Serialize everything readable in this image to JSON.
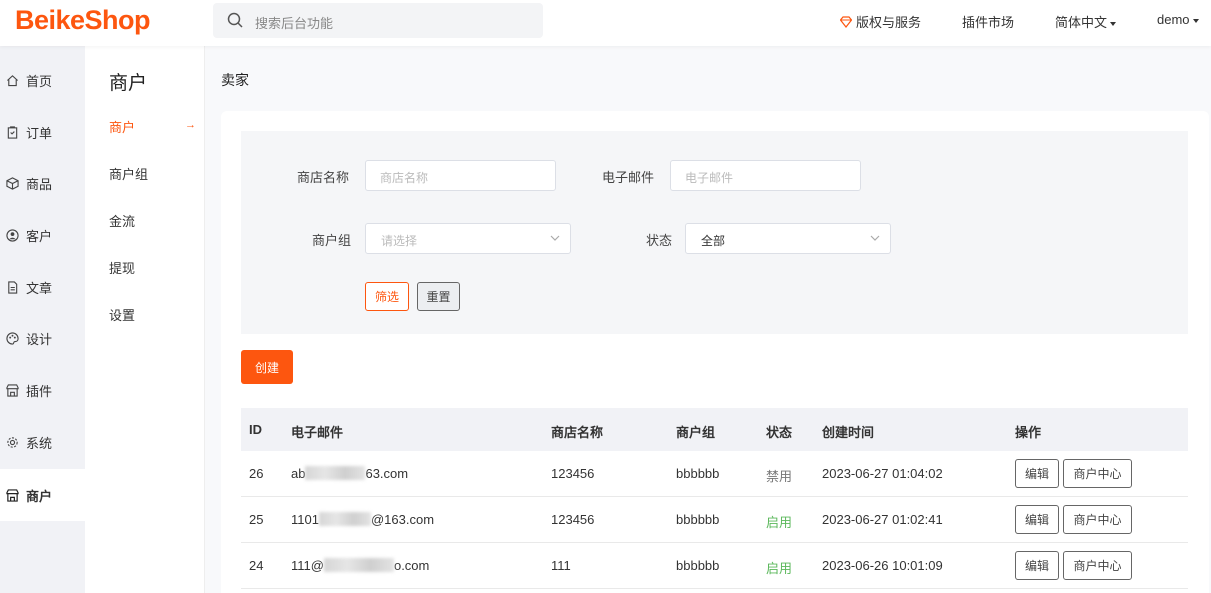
{
  "brand": "BeikeShop",
  "header": {
    "search_placeholder": "搜索后台功能",
    "nav": {
      "license": "版权与服务",
      "plugins": "插件市场",
      "language": "简体中文",
      "user": "demo"
    }
  },
  "sidebar": {
    "items": [
      {
        "label": "首页",
        "icon": "home-icon"
      },
      {
        "label": "订单",
        "icon": "clipboard-icon"
      },
      {
        "label": "商品",
        "icon": "box-icon"
      },
      {
        "label": "客户",
        "icon": "user-icon"
      },
      {
        "label": "文章",
        "icon": "document-icon"
      },
      {
        "label": "设计",
        "icon": "palette-icon"
      },
      {
        "label": "插件",
        "icon": "store-icon"
      },
      {
        "label": "系统",
        "icon": "gear-icon"
      }
    ],
    "active": {
      "label": "商户",
      "icon": "store-icon"
    }
  },
  "subnav": {
    "title": "商户",
    "items": [
      "商户",
      "商户组",
      "金流",
      "提现",
      "设置"
    ],
    "active_index": 0,
    "active_arrow": "→"
  },
  "page": {
    "title": "卖家",
    "filter": {
      "store_name_label": "商店名称",
      "store_name_placeholder": "商店名称",
      "email_label": "电子邮件",
      "email_placeholder": "电子邮件",
      "group_label": "商户组",
      "group_placeholder": "请选择",
      "status_label": "状态",
      "status_value": "全部",
      "filter_button": "筛选",
      "reset_button": "重置"
    },
    "create_button": "创建",
    "table": {
      "headers": [
        "ID",
        "电子邮件",
        "商店名称",
        "商户组",
        "状态",
        "创建时间",
        "操作"
      ],
      "rows": [
        {
          "id": "26",
          "email_pre": "ab",
          "email_post": "63.com",
          "store": "123456",
          "group": "bbbbbb",
          "status": "禁用",
          "status_color": "#777777",
          "created": "2023-06-27 01:04:02",
          "edit": "编辑",
          "center": "商户中心"
        },
        {
          "id": "25",
          "email_pre": "1101",
          "email_post": "@163.com",
          "store": "123456",
          "group": "bbbbbb",
          "status": "启用",
          "status_color": "#5cb85c",
          "created": "2023-06-27 01:02:41",
          "edit": "编辑",
          "center": "商户中心"
        },
        {
          "id": "24",
          "email_pre": "111@",
          "email_post": "o.com",
          "store": "111",
          "group": "bbbbbb",
          "status": "启用",
          "status_color": "#5cb85c",
          "created": "2023-06-26 10:01:09",
          "edit": "编辑",
          "center": "商户中心"
        }
      ]
    }
  },
  "colors": {
    "accent": "#fd560f",
    "enabled": "#5cb85c",
    "disabled": "#777777"
  }
}
